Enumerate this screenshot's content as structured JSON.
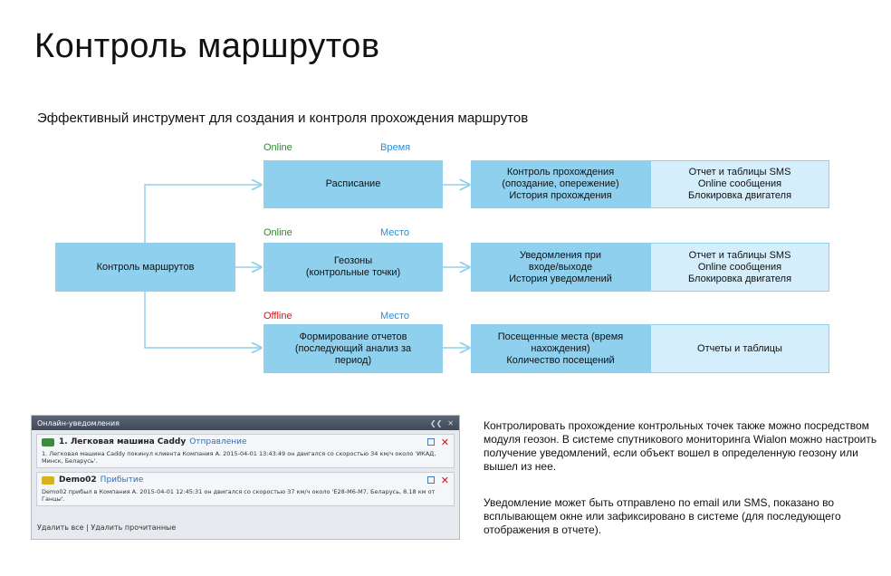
{
  "title": "Контроль маршрутов",
  "subtitle": "Эффективный инструмент для создания и контроля прохождения маршрутов",
  "diagram": {
    "root": "Контроль маршрутов",
    "rows": [
      {
        "mode": "Online",
        "kind": "Время",
        "box": "Расписание",
        "middle": "Контроль прохождения\n(опоздание, опережение)\nИстория прохождения",
        "right": "Отчет и таблицы SMS\nOnline сообщения\nБлокировка двигателя"
      },
      {
        "mode": "Online",
        "kind": "Место",
        "box": "Геозоны\n(контрольные точки)",
        "middle": "Уведомления при\nвходе/выходе\nИстория  уведомлений",
        "right": "Отчет и таблицы SMS\nOnline сообщения\nБлокировка двигателя"
      },
      {
        "mode": "Offline",
        "kind": "Место",
        "box": "Формирование отчетов\n(последующий анализ за\nпериод)",
        "middle": "Посещенные места (время\nнахождения)\nКоличество посещений",
        "right": "Отчеты и таблицы"
      }
    ]
  },
  "panel": {
    "header": "Онлайн-уведомления",
    "notifications": [
      {
        "name": "1. Легковая машина Caddy",
        "type": "Отправление",
        "text": "1. Легковая машина Caddy покинул клиента Компания А. 2015-04-01 13:43:49 он двигался со скоростью 34 км/ч около 'ИКАД, Минск, Беларусь'.",
        "color": "#3d8b3d"
      },
      {
        "name": "Demo02",
        "type": "Прибытие",
        "text": "Demo02 прибыл в Компания А. 2015-04-01 12:45:31 он двигался со скоростью 37 км/ч около 'E28-M6-M7, Беларусь, 8.18 км от Ганцы'.",
        "color": "#d8b21a"
      }
    ],
    "footer": "Удалить все  |  Удалить прочитанные"
  },
  "description": [
    "Контролировать прохождение контрольных точек также можно посредством модуля геозон. В системе спутникового мониторинга Wialon можно настроить получение уведомлений, если объект вошел в определенную геозону или вышел из нее.",
    "Уведомление может быть отправлено по email или SMS, показано во всплывающем окне или зафиксировано в системе (для последующего отображения в отчете)."
  ],
  "colors": {
    "box": "#8fd0ee",
    "pale_box": "#d4eefb",
    "online": "#2e8b2e",
    "offline": "#d01818",
    "kind": "#2a8fd0",
    "arrow": "#8fd0ee"
  }
}
